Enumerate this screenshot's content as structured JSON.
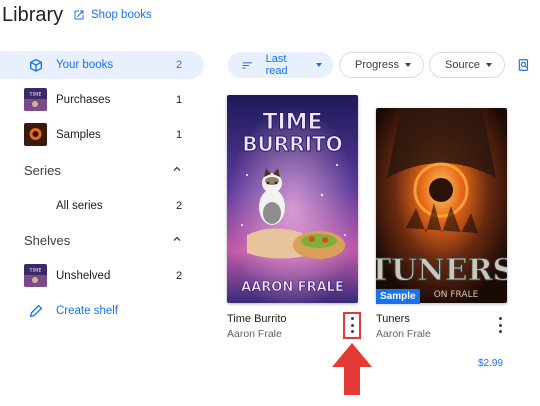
{
  "header": {
    "title": "Library",
    "shop_label": "Shop books"
  },
  "sidebar": {
    "items": [
      {
        "label": "Your books",
        "count": "2"
      },
      {
        "label": "Purchases",
        "count": "1"
      },
      {
        "label": "Samples",
        "count": "1"
      }
    ],
    "series": {
      "title": "Series",
      "items": [
        {
          "label": "All series",
          "count": "2"
        }
      ]
    },
    "shelves": {
      "title": "Shelves",
      "items": [
        {
          "label": "Unshelved",
          "count": "2"
        }
      ],
      "create_label": "Create shelf"
    }
  },
  "filters": {
    "chips": [
      {
        "label": "Last read"
      },
      {
        "label": "Progress"
      },
      {
        "label": "Source"
      }
    ]
  },
  "books": [
    {
      "title": "Time Burrito",
      "author": "Aaron Frale",
      "cover_title": "TIME BURRITO",
      "cover_author": "AARON FRALE"
    },
    {
      "title": "Tuners",
      "author": "Aaron Frale",
      "cover_title": "TUNERS",
      "cover_author": "ON FRALE",
      "badge": "Sample",
      "price": "$2.99"
    }
  ],
  "colors": {
    "accent": "#1a73e8",
    "highlight": "#e53935"
  }
}
